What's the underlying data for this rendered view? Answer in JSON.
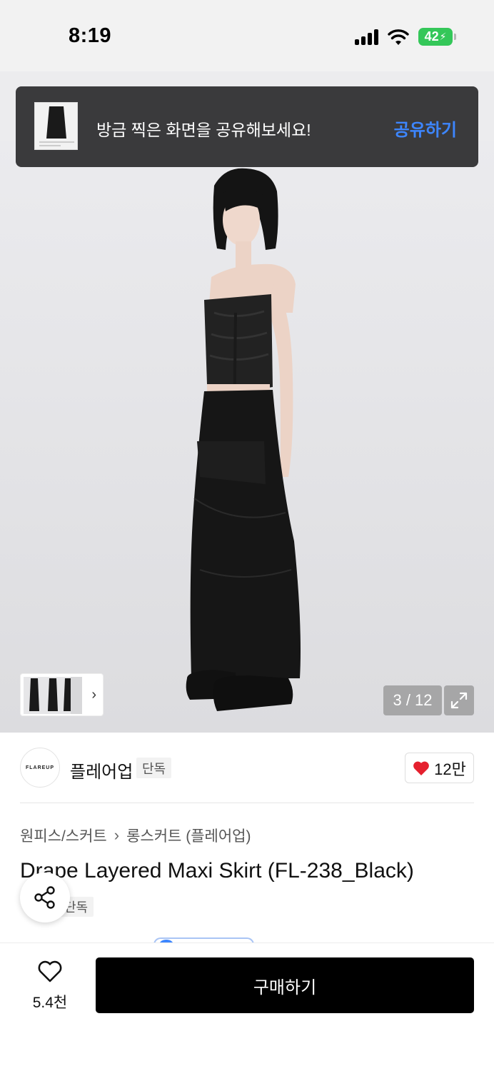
{
  "status_bar": {
    "time": "8:19",
    "battery": "42"
  },
  "toast": {
    "message": "방금 찍은 화면을 공유해보세요!",
    "action": "공유하기"
  },
  "gallery": {
    "counter": "3 / 12"
  },
  "brand": {
    "logo_text": "FLAREUP",
    "name": "플레어업",
    "badge": "단독",
    "like_count": "12만"
  },
  "product": {
    "breadcrumb": [
      "원피스/스커트",
      "롱스커트 (플레어업)"
    ],
    "title": "Drape Layered Maxi Skirt (FL-238_Black)",
    "badge": "단독"
  },
  "bottom_bar": {
    "wish_count": "5.4천",
    "buy_label": "구매하기"
  },
  "colors": {
    "toast_bg": "#3a3a3c",
    "toast_action": "#3d86ff",
    "heart": "#e5202e",
    "battery": "#34c759"
  },
  "icons": [
    "signal-icon",
    "wifi-icon",
    "battery-icon",
    "chevron-right-icon",
    "expand-icon",
    "heart-icon",
    "share-icon",
    "heart-outline-icon"
  ]
}
